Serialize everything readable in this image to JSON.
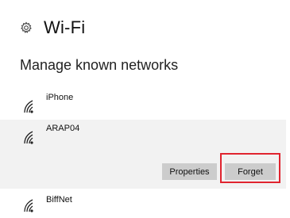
{
  "header": {
    "icon": "gear-icon",
    "title": "Wi-Fi"
  },
  "section": {
    "title": "Manage known networks"
  },
  "networks": [
    {
      "name": "iPhone",
      "icon": "wifi-icon"
    },
    {
      "name": "ARAP04",
      "icon": "wifi-icon",
      "selected": true
    },
    {
      "name": "BiffNet",
      "icon": "wifi-icon"
    }
  ],
  "actions": {
    "properties_label": "Properties",
    "forget_label": "Forget"
  },
  "colors": {
    "selected_background": "#f2f2f2",
    "button_background": "#cccccc",
    "highlight_border": "#e0242f"
  }
}
